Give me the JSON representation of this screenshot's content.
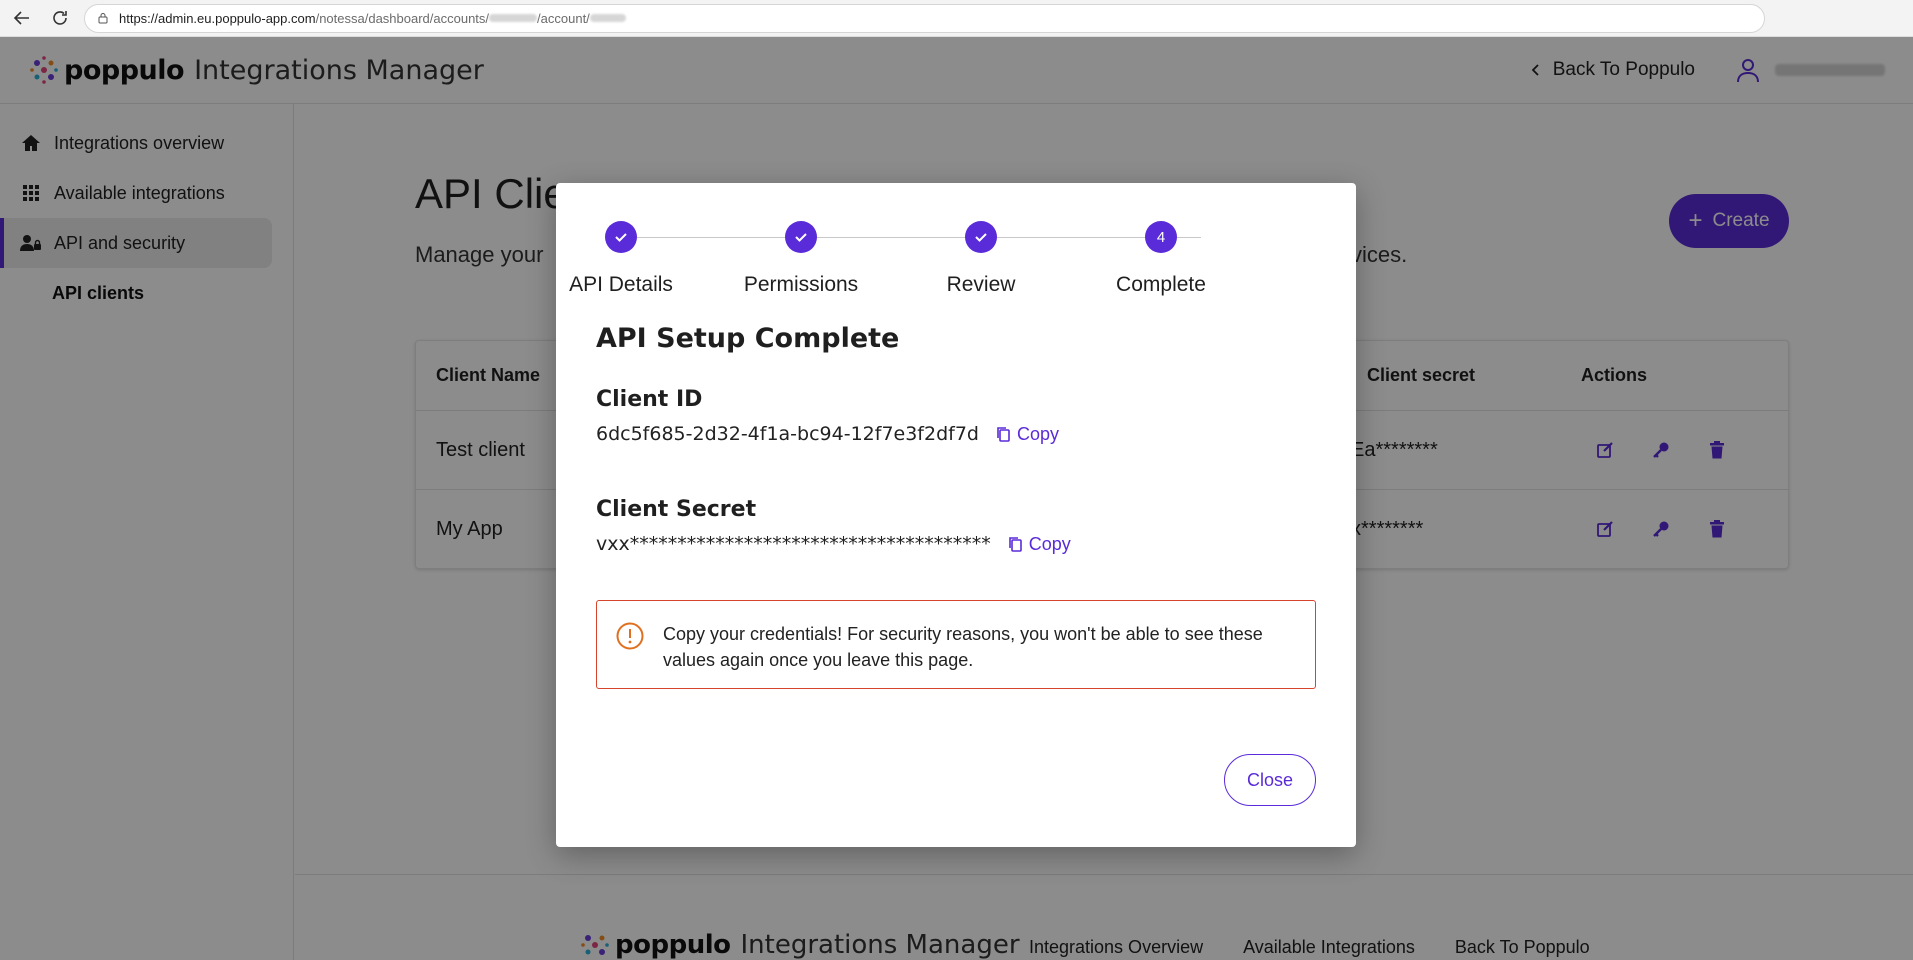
{
  "browser": {
    "url_main": "https://admin.eu.poppulo-app.com",
    "url_path1": "/notessa/dashboard/accounts/",
    "url_path2": "/account/"
  },
  "header": {
    "brand": "poppulo",
    "product": "Integrations Manager",
    "back_link": "Back To Poppulo"
  },
  "sidebar": {
    "items": [
      {
        "label": "Integrations overview",
        "icon": "home-icon"
      },
      {
        "label": "Available integrations",
        "icon": "grid-icon"
      },
      {
        "label": "API and security",
        "icon": "user-lock-icon"
      }
    ],
    "sub_item": "API clients"
  },
  "main": {
    "title": "API Clie",
    "subtitle": "Manage your",
    "subtitle_end": "vices.",
    "create_label": "Create",
    "table": {
      "headers": [
        "Client Name",
        "Client secret",
        "Actions"
      ],
      "rows": [
        {
          "name": "Test client",
          "secret": "Ea********"
        },
        {
          "name": "My App",
          "secret": "x********"
        }
      ]
    }
  },
  "footer": {
    "brand": "poppulo",
    "product": "Integrations Manager",
    "links": [
      "Integrations Overview",
      "Available Integrations",
      "Back To Poppulo"
    ]
  },
  "modal": {
    "steps": [
      {
        "label": "API Details",
        "state": "done"
      },
      {
        "label": "Permissions",
        "state": "done"
      },
      {
        "label": "Review",
        "state": "done"
      },
      {
        "label": "Complete",
        "state": "current",
        "number": "4"
      }
    ],
    "title": "API Setup Complete",
    "client_id_label": "Client ID",
    "client_id_value": "6dc5f685-2d32-4f1a-bc94-12f7e3f2df7d",
    "client_secret_label": "Client Secret",
    "client_secret_value": "vxx**************************************",
    "copy_label": "Copy",
    "warning": "Copy your credentials! For security reasons, you won't be able to see these values again once you leave this page.",
    "close_label": "Close"
  },
  "colors": {
    "accent": "#5a2bd8",
    "warning_border": "#d6452b",
    "warning_icon": "#e07020"
  }
}
